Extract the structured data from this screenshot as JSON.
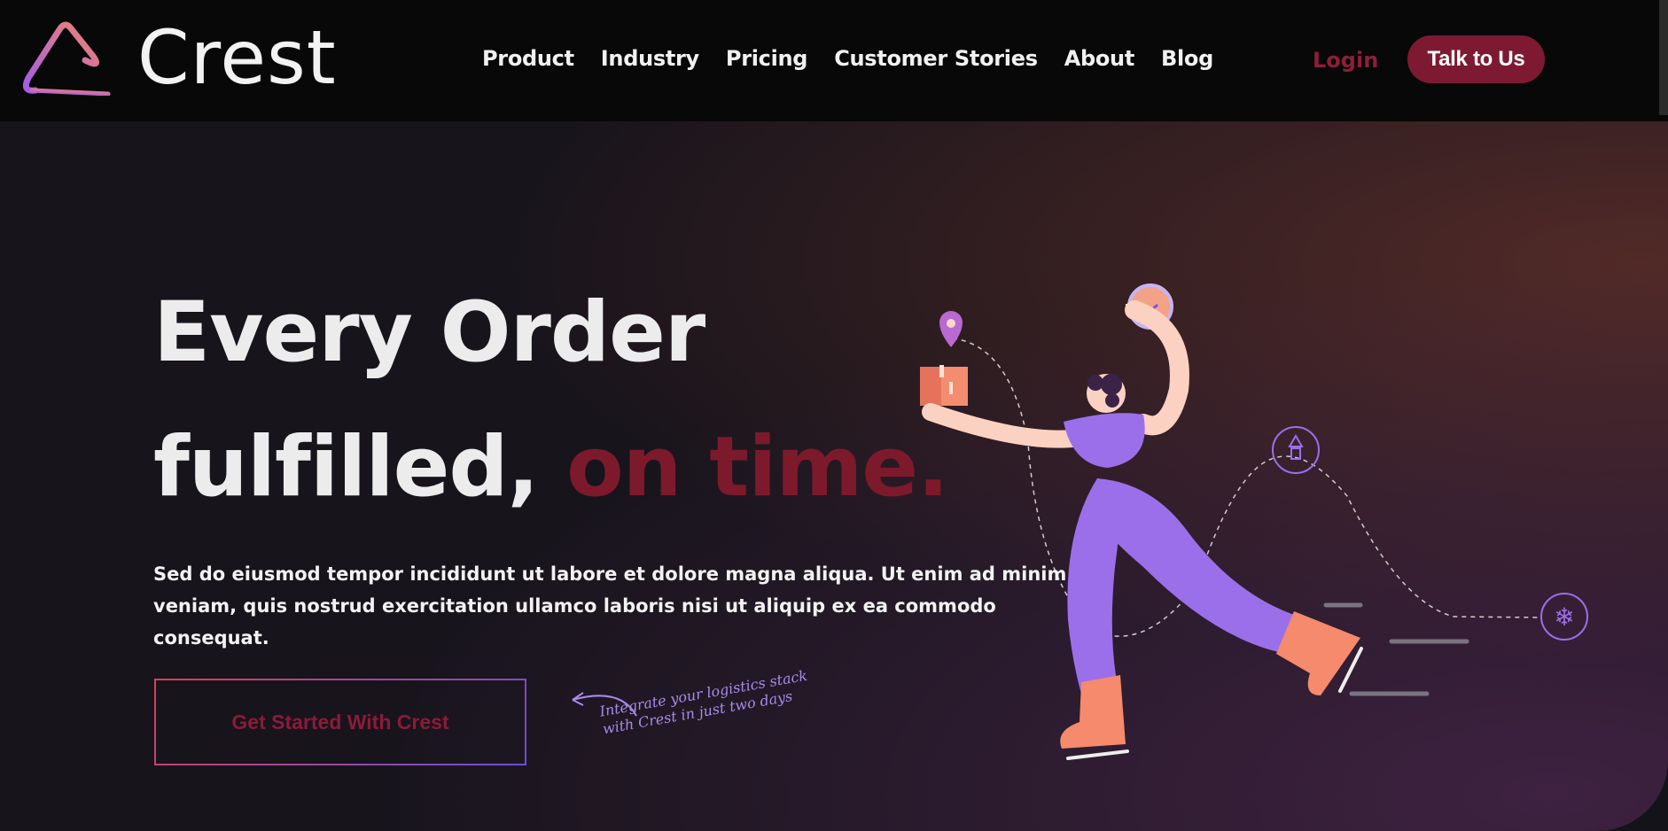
{
  "brand": {
    "name": "Crest"
  },
  "nav": {
    "items": [
      "Product",
      "Industry",
      "Pricing",
      "Customer Stories",
      "About",
      "Blog"
    ],
    "login": "Login",
    "cta": "Talk to Us"
  },
  "hero": {
    "title_line1": "Every Order",
    "title_line2_a": "fulfilled,",
    "title_line2_b": "on time.",
    "subtitle": "Sed do eiusmod tempor incididunt ut labore et dolore magna aliqua. Ut enim ad minim veniam, quis nostrud exercitation ullamco laboris nisi ut aliquip ex ea commodo consequat.",
    "cta": "Get Started With Crest",
    "note_line1": "Integrate your logistics stack",
    "note_line2": "with Crest in just two days"
  },
  "colors": {
    "accent": "#7c1a2c",
    "button": "#7d1a31",
    "purple": "#9b6fea",
    "orange": "#f58a6c"
  }
}
